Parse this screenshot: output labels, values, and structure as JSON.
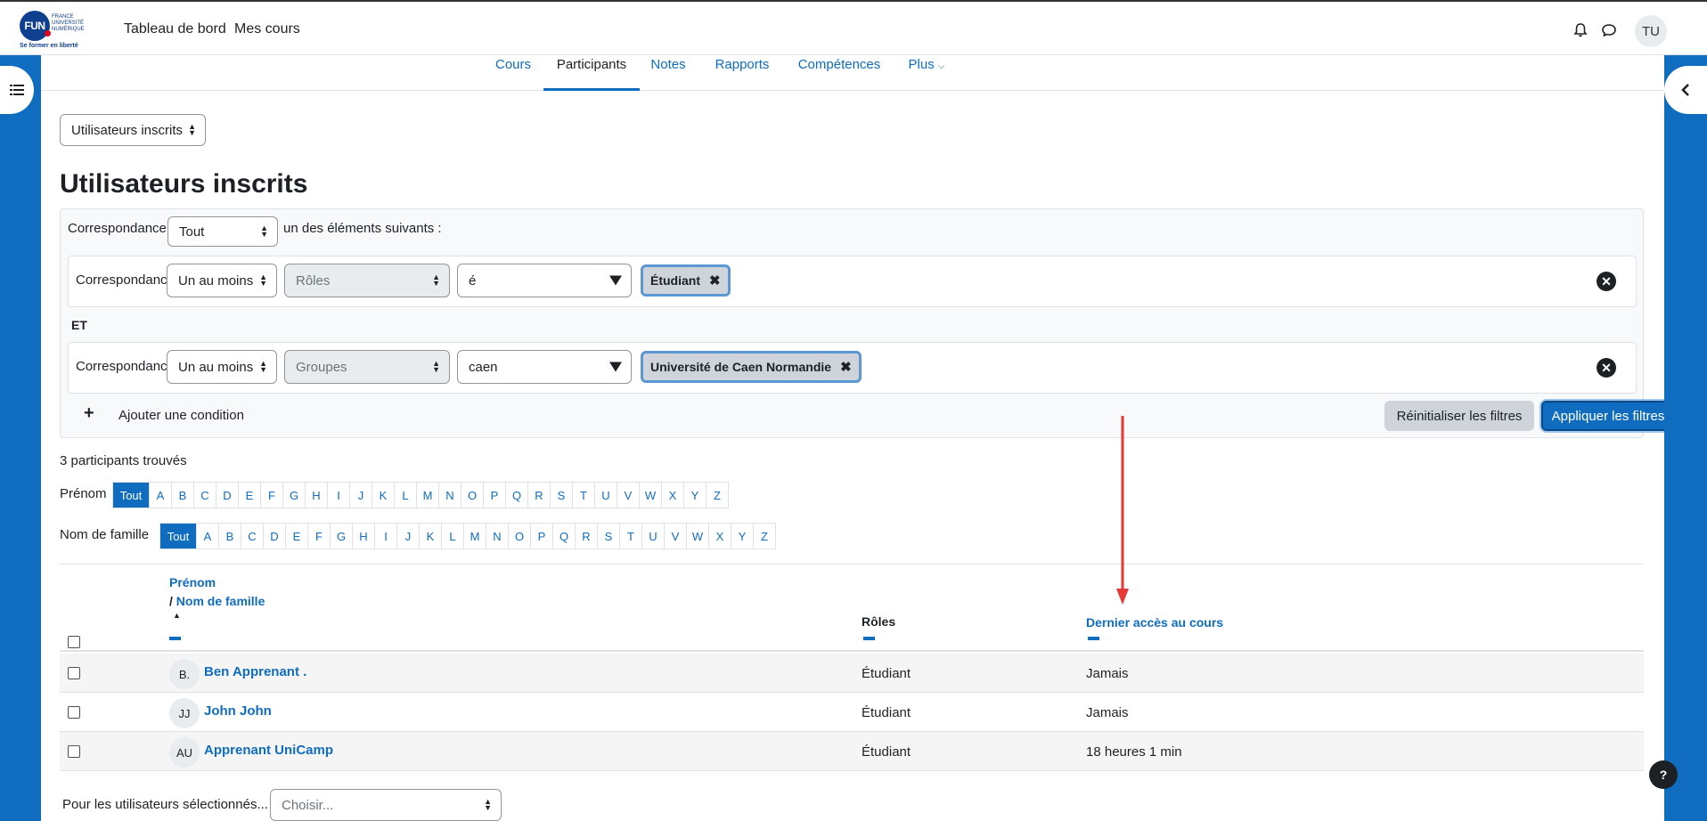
{
  "topbar": {
    "logo": {
      "mark": "FUN",
      "small": "FRANCE UNIVERSITÉ NUMÉRIQUE",
      "tagline": "Se former en liberté"
    },
    "nav": [
      "Tableau de bord",
      "Mes cours"
    ],
    "avatar": "TU"
  },
  "course_nav": {
    "tabs": [
      "Cours",
      "Participants",
      "Notes",
      "Rapports",
      "Compétences",
      "Plus"
    ],
    "active": "Participants"
  },
  "page_select": "Utilisateurs inscrits",
  "page_title": "Utilisateurs inscrits",
  "filters": {
    "match_label": "Correspondance",
    "match_value": "Tout",
    "match_suffix": "un des éléments suivants :",
    "joiner": "ET",
    "rows": [
      {
        "label": "Correspondance",
        "mode": "Un au moins",
        "field": "Rôles",
        "query": "é",
        "chip": "Étudiant"
      },
      {
        "label": "Correspondance",
        "mode": "Un au moins",
        "field": "Groupes",
        "query": "caen",
        "chip": "Université de Caen Normandie"
      }
    ],
    "add_condition": "Ajouter une condition",
    "reset": "Réinitialiser les filtres",
    "apply": "Appliquer les filtres"
  },
  "found": "3 participants trouvés",
  "initials": {
    "first_label": "Prénom",
    "last_label": "Nom de famille",
    "all": "Tout",
    "letters": [
      "A",
      "B",
      "C",
      "D",
      "E",
      "F",
      "G",
      "H",
      "I",
      "J",
      "K",
      "L",
      "M",
      "N",
      "O",
      "P",
      "Q",
      "R",
      "S",
      "T",
      "U",
      "V",
      "W",
      "X",
      "Y",
      "Z"
    ]
  },
  "table": {
    "col_first": "Prénom",
    "col_sep": "/",
    "col_last": "Nom de famille",
    "col_roles": "Rôles",
    "col_access": "Dernier accès au cours",
    "rows": [
      {
        "initials": "B.",
        "name": "Ben Apprenant .",
        "role": "Étudiant",
        "access": "Jamais"
      },
      {
        "initials": "JJ",
        "name": "John John",
        "role": "Étudiant",
        "access": "Jamais"
      },
      {
        "initials": "AU",
        "name": "Apprenant UniCamp",
        "role": "Étudiant",
        "access": "18 heures 1 min"
      }
    ]
  },
  "bulk": {
    "label": "Pour les utilisateurs sélectionnés...",
    "placeholder": "Choisir..."
  },
  "help": "?",
  "annotation_color": "#e53935"
}
